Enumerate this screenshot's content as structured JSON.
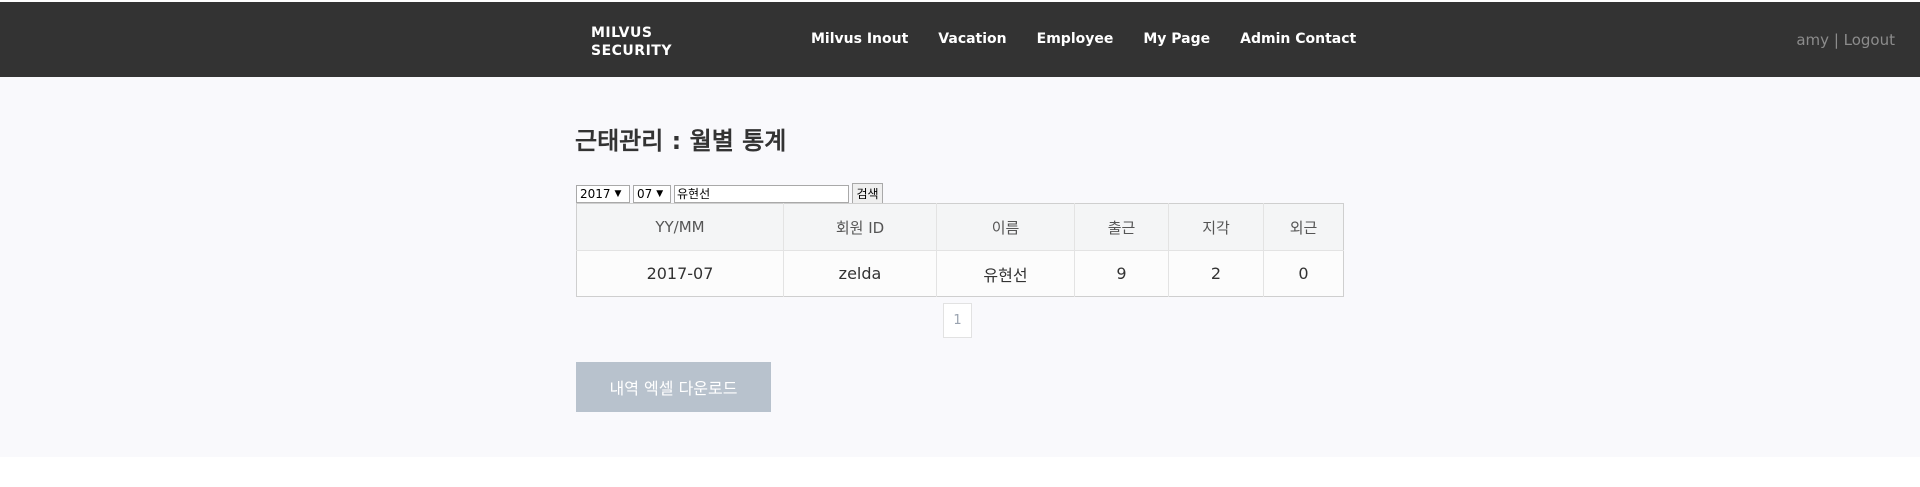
{
  "brand": {
    "line1": "MILVUS",
    "line2": "SECURITY"
  },
  "nav": [
    {
      "label": "Milvus Inout"
    },
    {
      "label": "Vacation"
    },
    {
      "label": "Employee"
    },
    {
      "label": "My Page"
    },
    {
      "label": "Admin Contact"
    }
  ],
  "user": {
    "name": "amy",
    "separator": " | ",
    "logout": "Logout"
  },
  "page": {
    "title": "근태관리 : 월별 통계"
  },
  "search": {
    "year": "2017",
    "month": "07",
    "name_value": "유현선",
    "button": "검색"
  },
  "table": {
    "headers": [
      "YY/MM",
      "회원 ID",
      "이름",
      "출근",
      "지각",
      "외근"
    ],
    "rows": [
      [
        "2017-07",
        "zelda",
        "유현선",
        "9",
        "2",
        "0"
      ]
    ]
  },
  "pagination": {
    "current": "1"
  },
  "download": {
    "label": "내역 엑셀 다운로드"
  }
}
